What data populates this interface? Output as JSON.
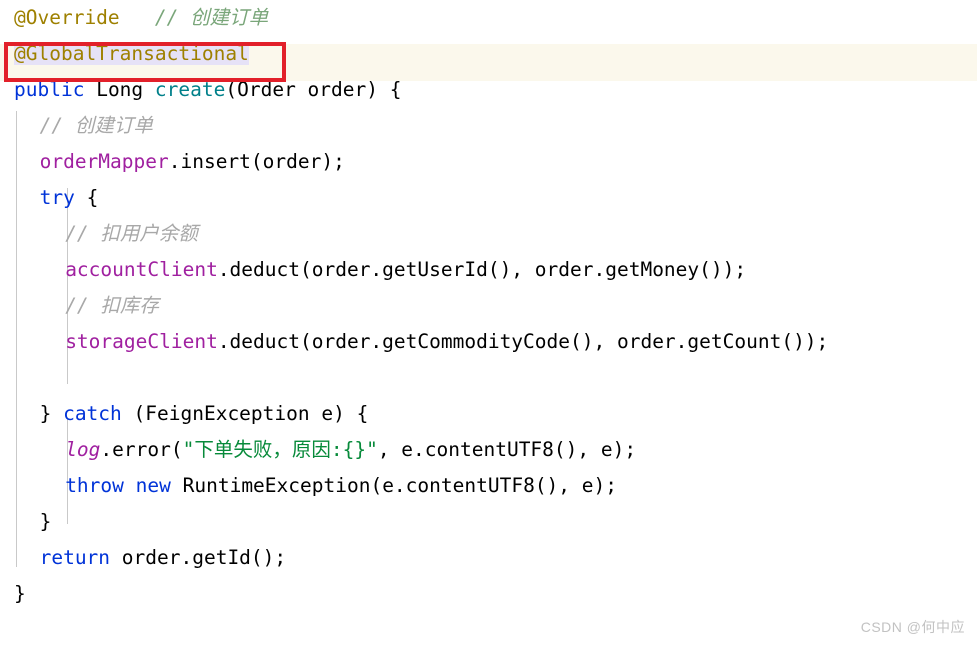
{
  "editor": {
    "language": "java",
    "watermark": "CSDN @何中应",
    "colors": {
      "background": "#ffffff",
      "caret_line": "#fbf8ec",
      "selection": "#e6e2f7",
      "annotation_box": "#e2202a",
      "annotation_token": "#9e8000",
      "keyword": "#0033d8",
      "method": "#00808a",
      "field": "#a020a0",
      "string": "#078a3a",
      "comment_green": "#7aa67a",
      "comment_gray": "#a8a8a8",
      "indent_guide": "#c9c9c9"
    },
    "highlighted_annotation": "@GlobalTransactional",
    "lines": [
      {
        "id": "line-override",
        "indent": 0,
        "tokens": [
          {
            "text": "@Override",
            "style": "anno"
          },
          {
            "text": "   ",
            "style": "plain"
          },
          {
            "text": "// 创建订单",
            "style": "cmt-green"
          }
        ]
      },
      {
        "id": "line-global-transactional",
        "indent": 0,
        "caret": true,
        "tokens": [
          {
            "text": "@GlobalTransactional",
            "style": "anno",
            "selected": true
          }
        ]
      },
      {
        "id": "line-method-signature",
        "indent": 0,
        "tokens": [
          {
            "text": "public",
            "style": "kw"
          },
          {
            "text": " ",
            "style": "plain"
          },
          {
            "text": "Long",
            "style": "type"
          },
          {
            "text": " ",
            "style": "plain"
          },
          {
            "text": "create",
            "style": "method"
          },
          {
            "text": "(Order order) {",
            "style": "plain"
          }
        ]
      },
      {
        "id": "line-comment-create-order",
        "indent": 1,
        "tokens": [
          {
            "text": "// 创建订单",
            "style": "cmt-gray"
          }
        ]
      },
      {
        "id": "line-order-mapper-insert",
        "indent": 1,
        "tokens": [
          {
            "text": "orderMapper",
            "style": "field"
          },
          {
            "text": ".insert(order);",
            "style": "plain"
          }
        ]
      },
      {
        "id": "line-try",
        "indent": 1,
        "tokens": [
          {
            "text": "try",
            "style": "kw"
          },
          {
            "text": " {",
            "style": "plain"
          }
        ]
      },
      {
        "id": "line-comment-deduct-balance",
        "indent": 2,
        "tokens": [
          {
            "text": "// 扣用户余额",
            "style": "cmt-gray"
          }
        ]
      },
      {
        "id": "line-account-client-deduct",
        "indent": 2,
        "tokens": [
          {
            "text": "accountClient",
            "style": "field"
          },
          {
            "text": ".deduct(order.getUserId(), order.getMoney());",
            "style": "plain"
          }
        ]
      },
      {
        "id": "line-comment-deduct-stock",
        "indent": 2,
        "tokens": [
          {
            "text": "// 扣库存",
            "style": "cmt-gray"
          }
        ]
      },
      {
        "id": "line-storage-client-deduct",
        "indent": 2,
        "tokens": [
          {
            "text": "storageClient",
            "style": "field"
          },
          {
            "text": ".deduct(order.getCommodityCode(), order.getCount());",
            "style": "plain"
          }
        ]
      },
      {
        "id": "line-blank-1",
        "indent": 0,
        "tokens": []
      },
      {
        "id": "line-catch",
        "indent": 1,
        "tokens": [
          {
            "text": "} ",
            "style": "plain"
          },
          {
            "text": "catch",
            "style": "kw"
          },
          {
            "text": " (FeignException e) {",
            "style": "plain"
          }
        ]
      },
      {
        "id": "line-log-error",
        "indent": 2,
        "tokens": [
          {
            "text": "log",
            "style": "field-i"
          },
          {
            "text": ".error(",
            "style": "plain"
          },
          {
            "text": "\"下单失败，原因:{}\"",
            "style": "str"
          },
          {
            "text": ", e.contentUTF8(), e);",
            "style": "plain"
          }
        ]
      },
      {
        "id": "line-throw-runtime-exception",
        "indent": 2,
        "tokens": [
          {
            "text": "throw",
            "style": "kw"
          },
          {
            "text": " ",
            "style": "plain"
          },
          {
            "text": "new",
            "style": "kw"
          },
          {
            "text": " RuntimeException(e.contentUTF8(), e);",
            "style": "plain"
          }
        ]
      },
      {
        "id": "line-close-try-catch",
        "indent": 1,
        "tokens": [
          {
            "text": "}",
            "style": "plain"
          }
        ]
      },
      {
        "id": "line-return",
        "indent": 1,
        "tokens": [
          {
            "text": "return",
            "style": "kw"
          },
          {
            "text": " order.getId();",
            "style": "plain"
          }
        ]
      },
      {
        "id": "line-close-method",
        "indent": 0,
        "tokens": [
          {
            "text": "}",
            "style": "plain"
          }
        ]
      }
    ]
  }
}
